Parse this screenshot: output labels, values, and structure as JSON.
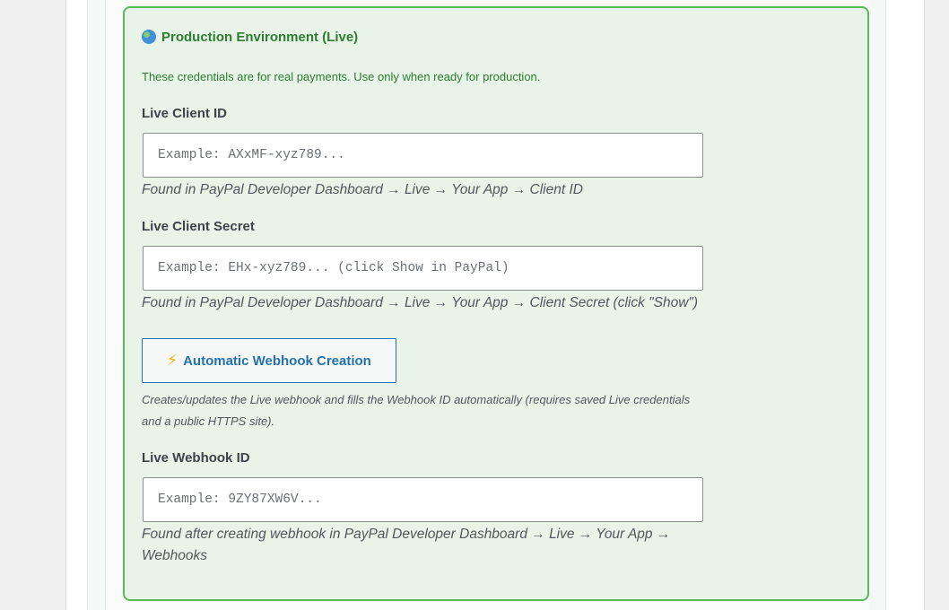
{
  "section": {
    "title": "Production Environment (Live)",
    "title_icon": "globe-icon",
    "notice": "These credentials are for real payments. Use only when ready for production."
  },
  "fields": {
    "client_id": {
      "label": "Live Client ID",
      "value": "",
      "placeholder": "Example: AXxMF-xyz789...",
      "help": "Found in PayPal Developer Dashboard → Live → Your App → Client ID"
    },
    "client_secret": {
      "label": "Live Client Secret",
      "value": "",
      "placeholder": "Example: EHx-xyz789... (click Show in PayPal)",
      "help": "Found in PayPal Developer Dashboard → Live → Your App → Client Secret (click \"Show\")"
    },
    "webhook_id": {
      "label": "Live Webhook ID",
      "value": "",
      "placeholder": "Example: 9ZY87XW6V...",
      "help": "Found after creating webhook in PayPal Developer Dashboard → Live → Your App → Webhooks"
    }
  },
  "webhook_button": {
    "icon": "lightning-icon",
    "icon_glyph": "⚡",
    "label": "Automatic Webhook Creation",
    "description": "Creates/updates the Live webhook and fills the Webhook ID automatically (requires saved Live credentials and a public HTTPS site)."
  },
  "colors": {
    "card_background": "#e8f4e8",
    "card_border": "#5cb85c",
    "title_green": "#2e7d32",
    "button_blue": "#2271b1"
  }
}
